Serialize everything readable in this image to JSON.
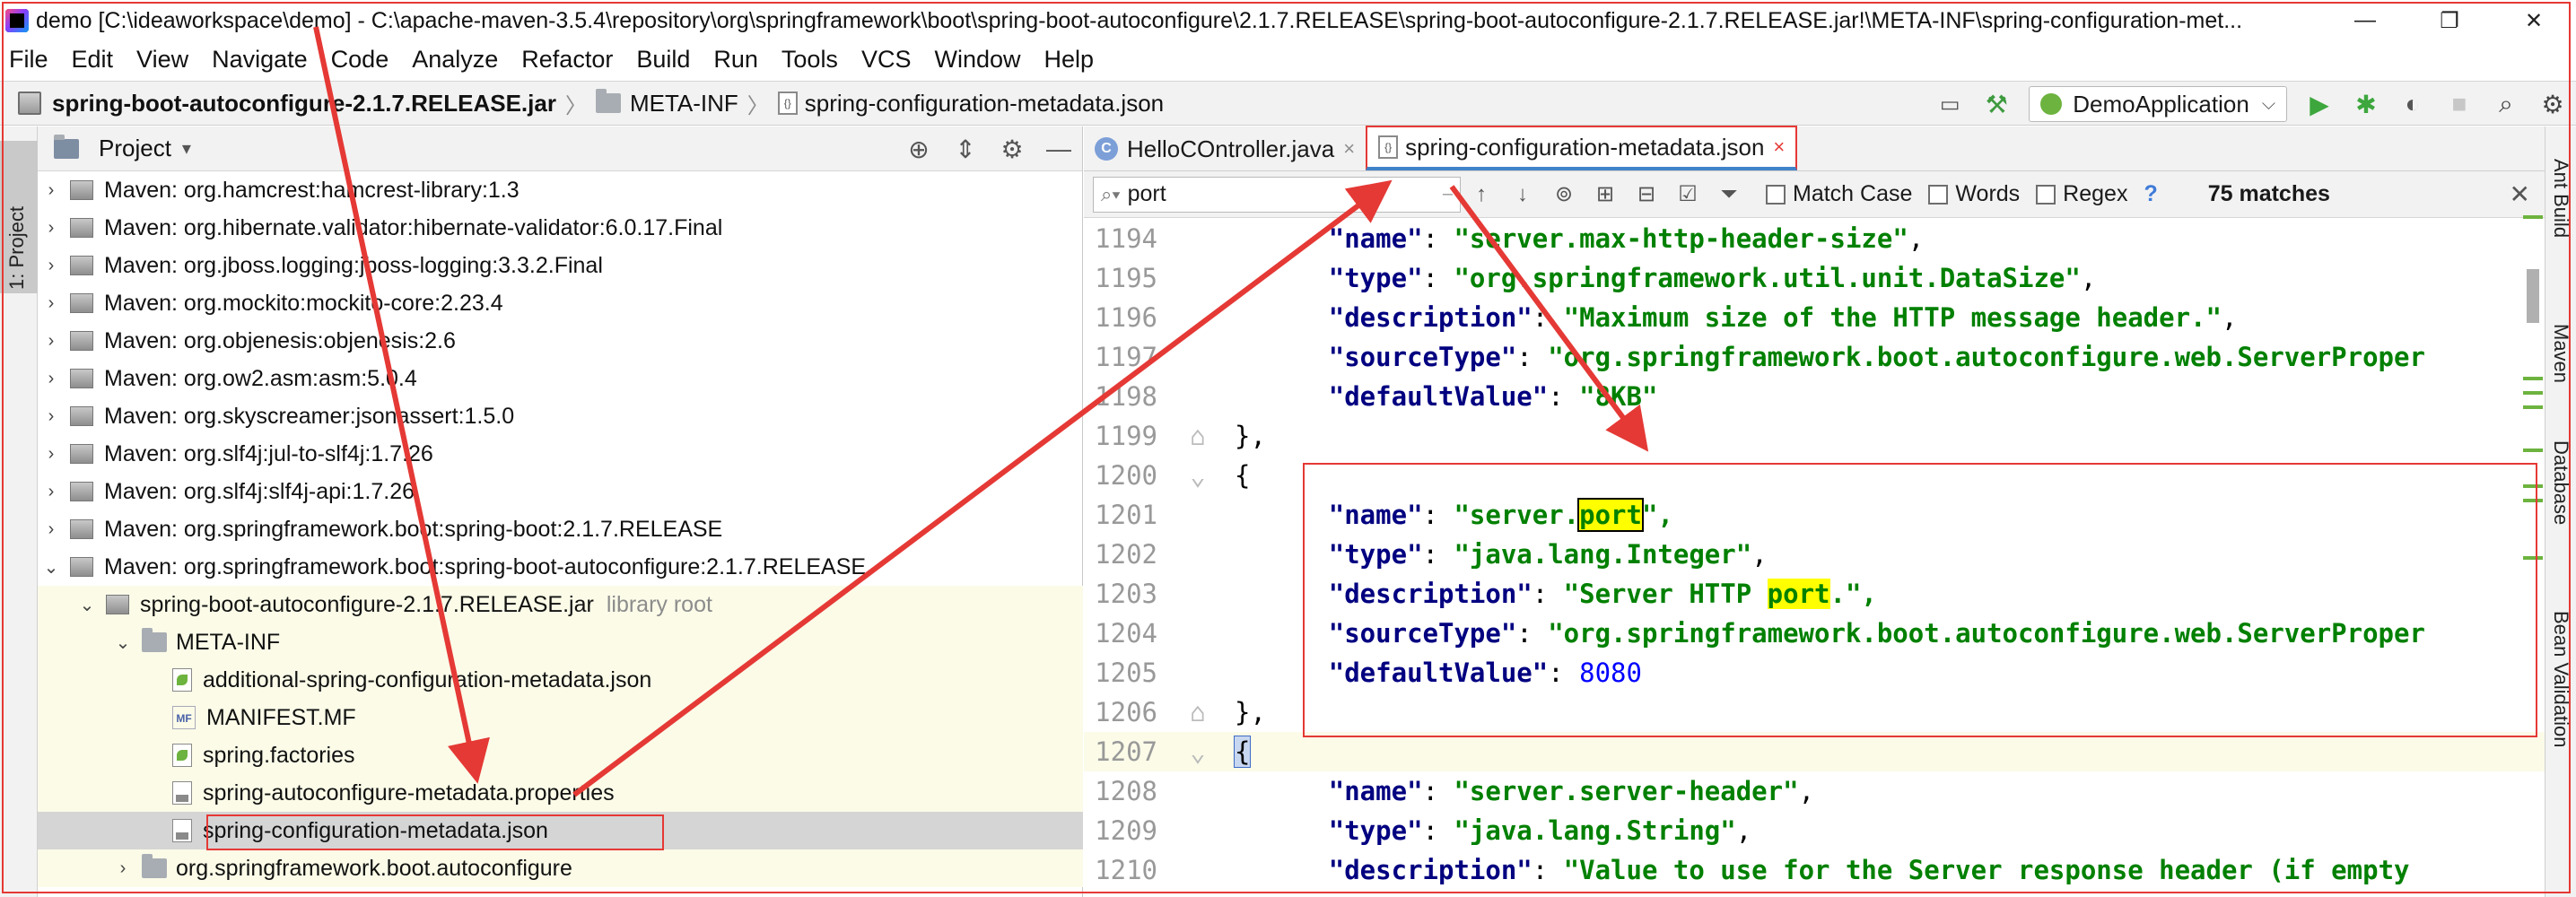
{
  "window": {
    "title": "demo [C:\\ideaworkspace\\demo] - C:\\apache-maven-3.5.4\\repository\\org\\springframework\\boot\\spring-boot-autoconfigure\\2.1.7.RELEASE\\spring-boot-autoconfigure-2.1.7.RELEASE.jar!\\META-INF\\spring-configuration-met...",
    "minimize": "—",
    "maximize": "❐",
    "close": "✕"
  },
  "menu": [
    "File",
    "Edit",
    "View",
    "Navigate",
    "Code",
    "Analyze",
    "Refactor",
    "Build",
    "Run",
    "Tools",
    "VCS",
    "Window",
    "Help"
  ],
  "breadcrumb": {
    "jar": "spring-boot-autoconfigure-2.1.7.RELEASE.jar",
    "folder": "META-INF",
    "file": "spring-configuration-metadata.json"
  },
  "toolbar": {
    "run_config": "DemoApplication"
  },
  "left_strip": {
    "label": "1: Project"
  },
  "project_panel": {
    "title": "Project",
    "rows": [
      {
        "label": "Maven: org.hamcrest:hamcrest-library:1.3"
      },
      {
        "label": "Maven: org.hibernate.validator:hibernate-validator:6.0.17.Final"
      },
      {
        "label": "Maven: org.jboss.logging:jboss-logging:3.3.2.Final"
      },
      {
        "label": "Maven: org.mockito:mockito-core:2.23.4"
      },
      {
        "label": "Maven: org.objenesis:objenesis:2.6"
      },
      {
        "label": "Maven: org.ow2.asm:asm:5.0.4"
      },
      {
        "label": "Maven: org.skyscreamer:jsonassert:1.5.0"
      },
      {
        "label": "Maven: org.slf4j:jul-to-slf4j:1.7.26"
      },
      {
        "label": "Maven: org.slf4j:slf4j-api:1.7.26"
      },
      {
        "label": "Maven: org.springframework.boot:spring-boot:2.1.7.RELEASE"
      },
      {
        "label": "Maven: org.springframework.boot:spring-boot-autoconfigure:2.1.7.RELEASE"
      },
      {
        "label": "spring-boot-autoconfigure-2.1.7.RELEASE.jar",
        "suffix": "library root"
      },
      {
        "label": "META-INF"
      },
      {
        "label": "additional-spring-configuration-metadata.json"
      },
      {
        "label": "MANIFEST.MF"
      },
      {
        "label": "spring.factories"
      },
      {
        "label": "spring-autoconfigure-metadata.properties"
      },
      {
        "label": "spring-configuration-metadata.json"
      },
      {
        "label": "org.springframework.boot.autoconfigure"
      }
    ]
  },
  "editor": {
    "tabs": [
      {
        "label": "HelloCOntroller.java",
        "close": "×"
      },
      {
        "label": "spring-configuration-metadata.json",
        "close": "×"
      }
    ],
    "find": {
      "query": "port",
      "match_case": "Match Case",
      "words": "Words",
      "regex": "Regex",
      "help": "?",
      "matches": "75 matches",
      "close": "✕"
    },
    "lines": [
      {
        "n": "1194"
      },
      {
        "n": "1195"
      },
      {
        "n": "1196"
      },
      {
        "n": "1197"
      },
      {
        "n": "1198"
      },
      {
        "n": "1199"
      },
      {
        "n": "1200"
      },
      {
        "n": "1201"
      },
      {
        "n": "1202"
      },
      {
        "n": "1203"
      },
      {
        "n": "1204"
      },
      {
        "n": "1205"
      },
      {
        "n": "1206"
      },
      {
        "n": "1207"
      },
      {
        "n": "1208"
      },
      {
        "n": "1209"
      },
      {
        "n": "1210"
      }
    ],
    "code": {
      "l1194_key": "\"name\"",
      "l1194_val": "\"server.max-http-header-size\"",
      "l1195_key": "\"type\"",
      "l1195_val": "\"org.springframework.util.unit.DataSize\"",
      "l1196_key": "\"description\"",
      "l1196_val": "\"Maximum size of the HTTP message header.\"",
      "l1197_key": "\"sourceType\"",
      "l1197_val": "\"org.springframework.boot.autoconfigure.web.ServerProper",
      "l1198_key": "\"defaultValue\"",
      "l1198_val": "\"8KB\"",
      "l1199": "},",
      "l1200": "{",
      "l1201_key": "\"name\"",
      "l1201_pre": "\"server.",
      "l1201_hl": "port",
      "l1201_post": "\",",
      "l1202_key": "\"type\"",
      "l1202_val": "\"java.lang.Integer\"",
      "l1203_key": "\"description\"",
      "l1203_pre": "\"Server HTTP ",
      "l1203_hl": "port",
      "l1203_post": ".\",",
      "l1204_key": "\"sourceType\"",
      "l1204_val": "\"org.springframework.boot.autoconfigure.web.ServerProper",
      "l1205_key": "\"defaultValue\"",
      "l1205_val": "8080",
      "l1206": "},",
      "l1207": "{",
      "l1208_key": "\"name\"",
      "l1208_val": "\"server.server-header\"",
      "l1209_key": "\"type\"",
      "l1209_val": "\"java.lang.String\"",
      "l1210_key": "\"description\"",
      "l1210_val": "\"Value to use for the Server response header (if empty"
    }
  },
  "right_strip": [
    "Ant Build",
    "Maven",
    "Database",
    "Bean Validation"
  ],
  "colors": {
    "annotation_red": "#e53935",
    "json_key": "#000080",
    "json_string": "#008000",
    "json_number": "#0000ff",
    "search_highlight": "#ffff00"
  }
}
